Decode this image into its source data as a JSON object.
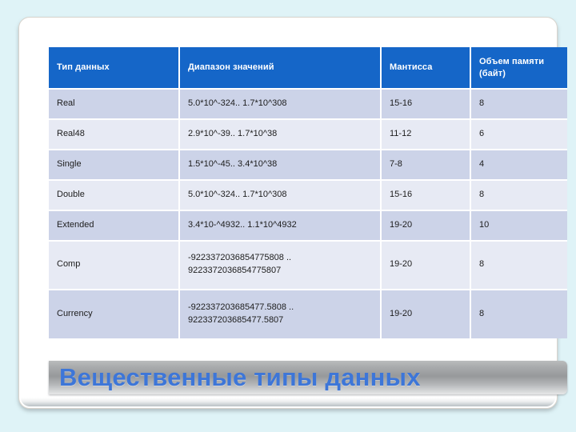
{
  "slide": {
    "title": "Вещественные типы данных",
    "background_color": "#dff3f7",
    "accent_color": "#1566c8",
    "title_color": "#3d76d8"
  },
  "table": {
    "headers": [
      "Тип данных",
      "Диапазон значений",
      "Мантисса",
      "Объем памяти (байт)"
    ],
    "rows": [
      {
        "type": "Real",
        "range": "5.0*10^-324.. 1.7*10^308",
        "mantissa": "15-16",
        "memory": "8"
      },
      {
        "type": "Real48",
        "range": "2.9*10^-39.. 1.7*10^38",
        "mantissa": "11-12",
        "memory": "6"
      },
      {
        "type": "Single",
        "range": "1.5*10^-45.. 3.4*10^38",
        "mantissa": "7-8",
        "memory": "4"
      },
      {
        "type": "Double",
        "range": "5.0*10^-324.. 1.7*10^308",
        "mantissa": "15-16",
        "memory": "8"
      },
      {
        "type": "Extended",
        "range": "3.4*10-^4932.. 1.1*10^4932",
        "mantissa": "19-20",
        "memory": "10"
      },
      {
        "type": "Comp",
        "range": "-9223372036854775808 ..\n9223372036854775807",
        "mantissa": "19-20",
        "memory": "8"
      },
      {
        "type": "Currency",
        "range": "-922337203685477.5808 ..\n922337203685477.5807",
        "mantissa": "19-20",
        "memory": "8"
      }
    ]
  }
}
